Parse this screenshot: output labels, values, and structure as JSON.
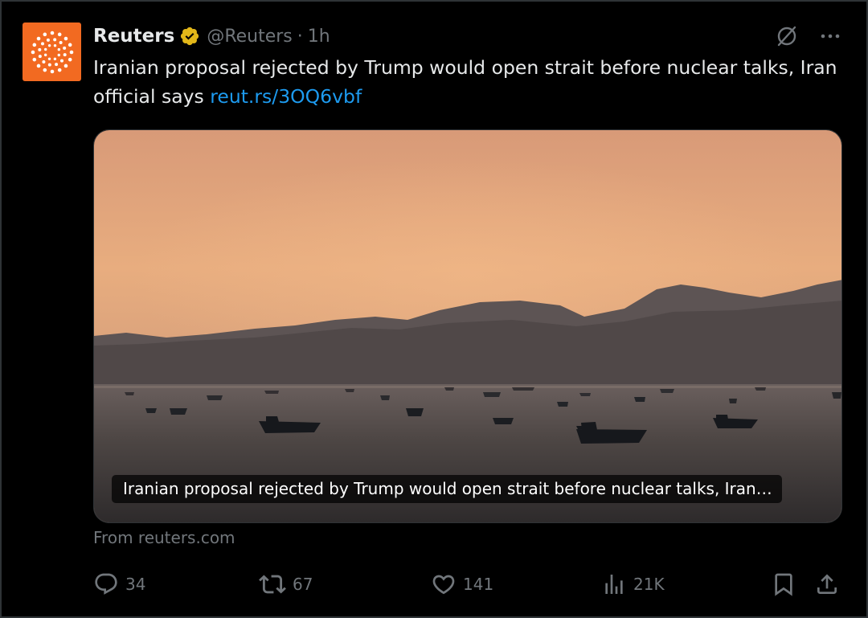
{
  "tweet": {
    "author_name": "Reuters",
    "handle": "@Reuters",
    "separator": "·",
    "time": "1h",
    "text": "Iranian proposal rejected by Trump would open strait before nuclear talks, Iran official says ",
    "link_text": "reut.rs/3OQ6vbf",
    "verified_badge": "gold-check",
    "avatar_color": "#f26a21"
  },
  "card": {
    "caption": "Iranian proposal rejected by Trump would open strait before nuclear talks, Iran…",
    "source": "From reuters.com"
  },
  "metrics": {
    "replies": "34",
    "reposts": "67",
    "likes": "141",
    "views": "21K"
  },
  "icons": {
    "grok": "grok-icon",
    "more": "more-options-icon",
    "reply": "reply-icon",
    "repost": "repost-icon",
    "like": "heart-icon",
    "views": "views-icon",
    "bookmark": "bookmark-icon",
    "share": "share-icon"
  },
  "colors": {
    "background": "#000000",
    "text": "#e7e9ea",
    "muted": "#71767b",
    "link": "#1d9bf0",
    "verified": "#e2b719"
  }
}
